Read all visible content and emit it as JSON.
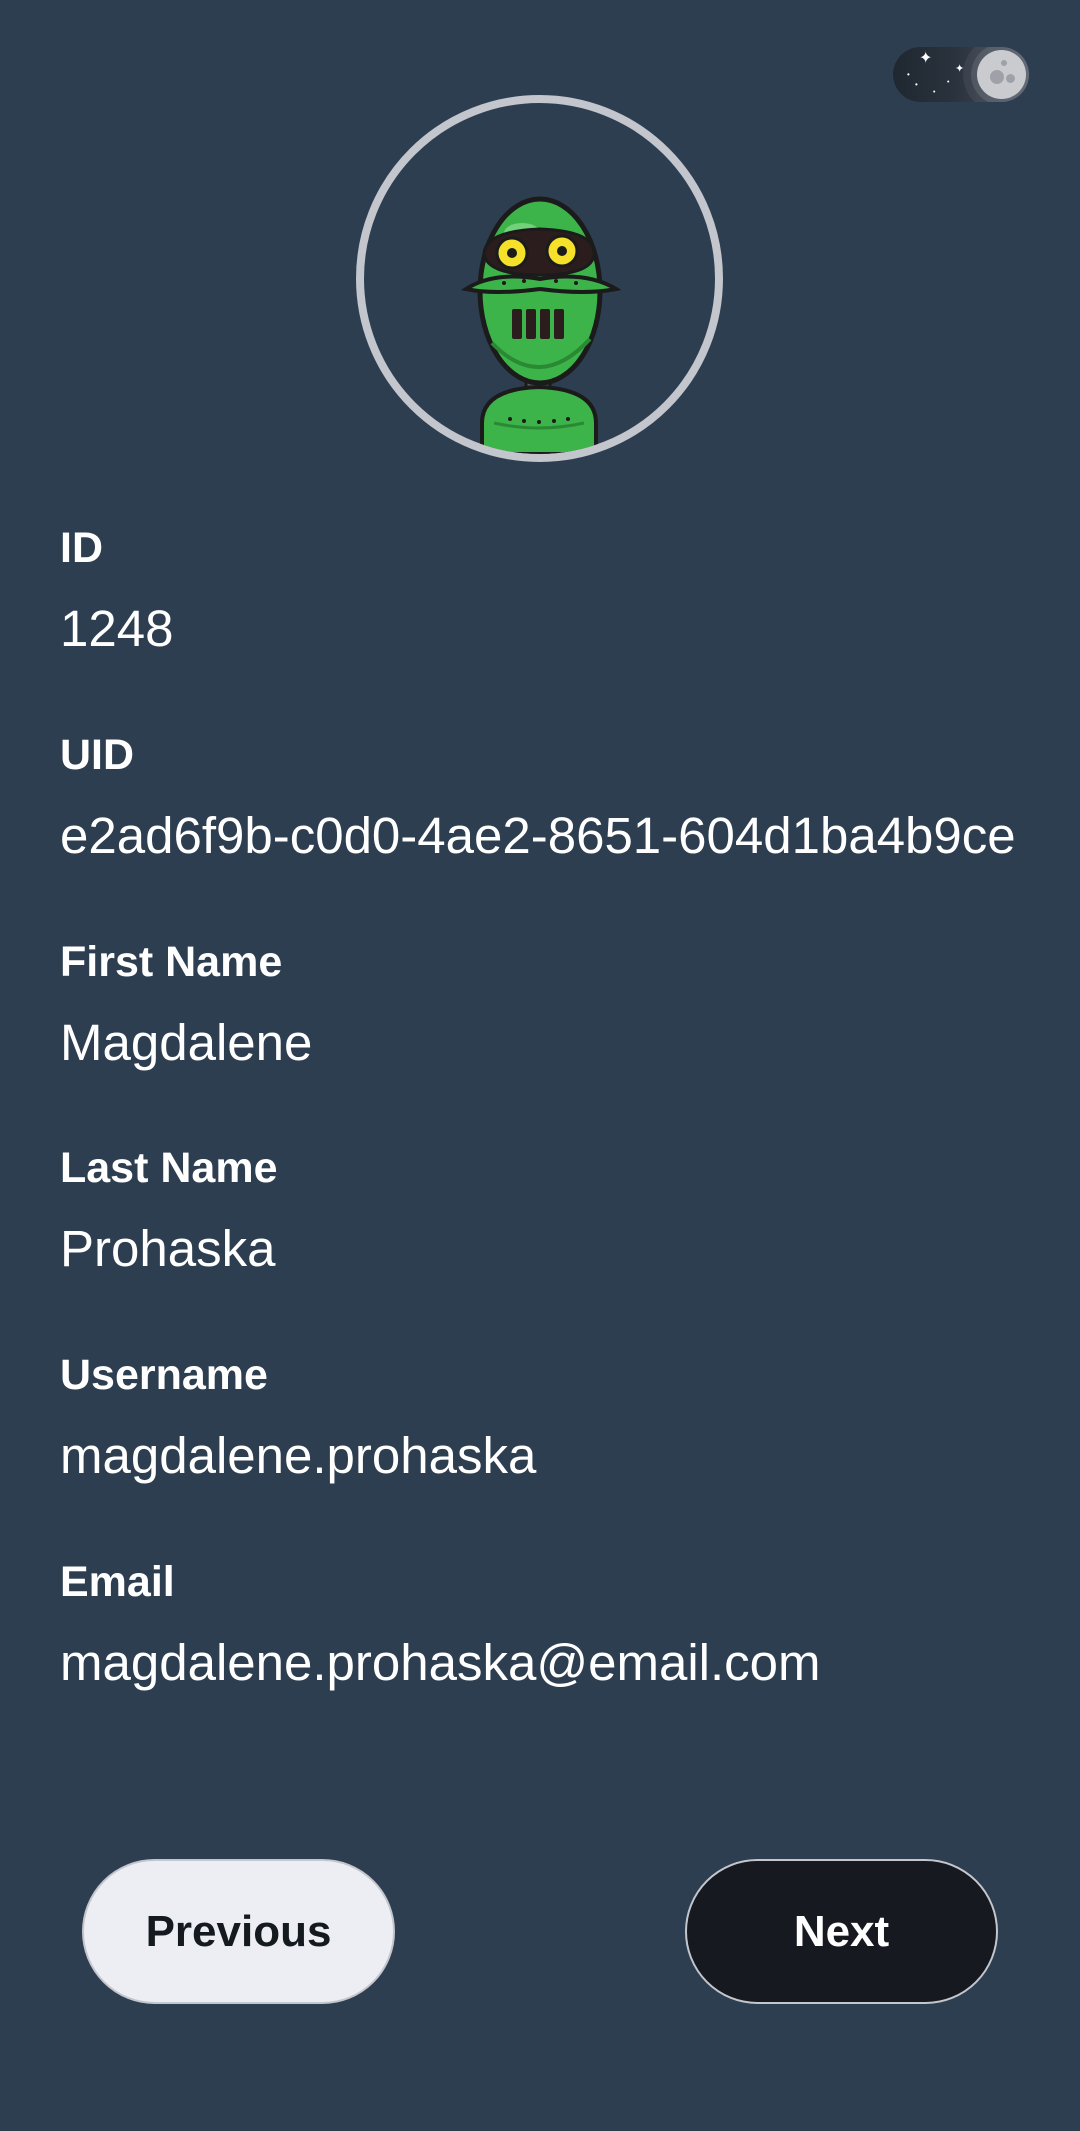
{
  "theme_toggle": {
    "state": "dark",
    "icon": "moon-icon"
  },
  "avatar": {
    "icon": "robot-avatar",
    "colors": {
      "body": "#3cb449",
      "ring": "#c3c6cc",
      "eyes": "#f5e12a"
    }
  },
  "fields": [
    {
      "label": "ID",
      "value": "1248"
    },
    {
      "label": "UID",
      "value": "e2ad6f9b-c0d0-4ae2-8651-604d1ba4b9ce"
    },
    {
      "label": "First Name",
      "value": "Magdalene"
    },
    {
      "label": "Last Name",
      "value": "Prohaska"
    },
    {
      "label": "Username",
      "value": "magdalene.prohaska"
    },
    {
      "label": "Email",
      "value": "magdalene.prohaska@email.com"
    }
  ],
  "nav": {
    "previous_label": "Previous",
    "next_label": "Next"
  },
  "colors": {
    "background": "#2e3e51",
    "text": "#ffffff",
    "previous_button_bg": "#eceef4",
    "next_button_bg": "#161a20"
  }
}
